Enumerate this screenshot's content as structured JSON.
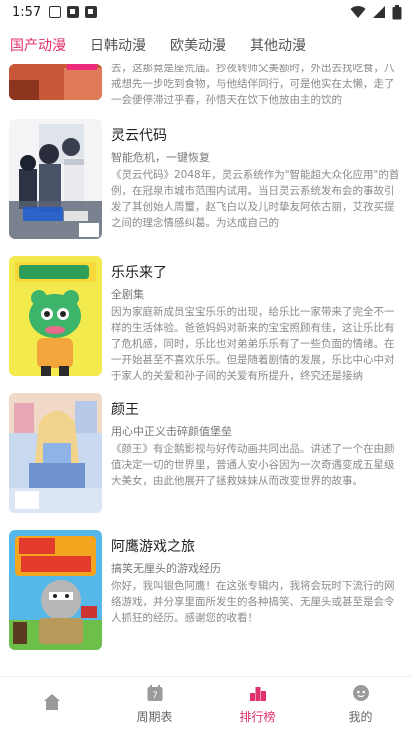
{
  "status": {
    "time": "1:57"
  },
  "tabs": [
    {
      "label": "国产动漫",
      "active": true
    },
    {
      "label": "日韩动漫",
      "active": false
    },
    {
      "label": "欧美动漫",
      "active": false
    },
    {
      "label": "其他动漫",
      "active": false
    }
  ],
  "items": [
    {
      "title": "",
      "subtitle": "",
      "desc": "去，这那竟是座荒庙。抄夜转师父美额时，外出去找吃食，八戒想先一步吃到食物，与他结伴同行，可是他实在太懒，走了一会便停滞过乎春，孙悟天在饮下他放由主的饮的"
    },
    {
      "title": "灵云代码",
      "subtitle": "智能危机，一键恢复",
      "desc": "《灵云代码》2048年，灵云系统作为\"智能超大众化应用\"的首例，在冠泉市城市范围内试用。当日灵云系统发布会的事故引发了其创始人周璽，赵飞白以及儿时挚友阿依古丽，艾孜买提之间的理念情感纠葛。为达成自己的"
    },
    {
      "title": "乐乐来了",
      "subtitle": "全剧集",
      "desc": "因为家庭新成员宝宝乐乐的出现，给乐比一家带来了完全不一样的生活体验。爸爸妈妈对新来的宝宝照顾有佳，这让乐比有了危机感，同时，乐比也对弟弟乐乐有了一些负面的情绪。在一开始甚至不喜欢乐乐。但是随着剧情的发展，乐比中心中对于家人的关爱和孙子间的关爱有所提升，终究还是接纳"
    },
    {
      "title": "颜王",
      "subtitle": "用心中正义击碎颜值堡垒",
      "desc": "《颜王》有企鹅影视与好传动画共同出品。讲述了一个在由颜值决定一切的世界里，普通人安小谷因为一次奇遇变成五星级大美女，由此他展开了拯救妹妹从而改变世界的故事。"
    },
    {
      "title": "阿鹰游戏之旅",
      "subtitle": "搞笑无厘头的游戏经历",
      "desc": "你好，我叫银色阿鹰！在这张专辑内，我将会玩时下流行的网络游戏，并分享里面所发生的各种搞笑、无厘头或甚至是会令人抓狂的经历。感谢您的收看！"
    }
  ],
  "nav": [
    {
      "label": "",
      "icon": "home-icon",
      "active": false
    },
    {
      "label": "周期表",
      "icon": "calendar-icon",
      "active": false
    },
    {
      "label": "排行榜",
      "icon": "ranking-icon",
      "active": true
    },
    {
      "label": "我的",
      "icon": "profile-icon",
      "active": false
    }
  ],
  "colors": {
    "accent": "#e0306e"
  }
}
